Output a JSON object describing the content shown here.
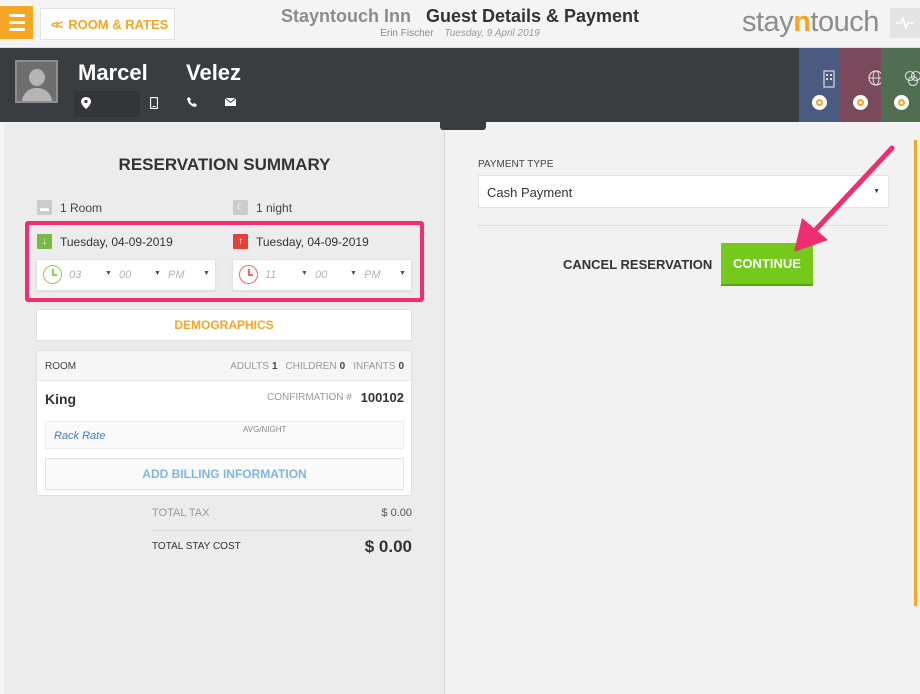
{
  "header": {
    "back_label": "ROOM & RATES",
    "hotel_name": "Stayntouch Inn",
    "page_title": "Guest Details & Payment",
    "user_name": "Erin Fischer",
    "business_date": "Tuesday, 9 April 2019",
    "logo_part1": "stay",
    "logo_part2": "n",
    "logo_part3": "touch",
    "icons": {
      "menu": "hamburger-icon",
      "back": "double-chevron-left-icon",
      "logo_button": "heartbeat-icon"
    }
  },
  "guest": {
    "first_name": "Marcel",
    "last_name": "Velez",
    "icons": [
      "location-pin-icon",
      "mobile-phone-icon",
      "phone-icon",
      "email-icon"
    ]
  },
  "tiles": [
    {
      "name": "building",
      "color": "#4a5a80",
      "glyph": "▥"
    },
    {
      "name": "globe",
      "color": "#7a4a5c",
      "glyph": "⊕"
    },
    {
      "name": "rings",
      "color": "#4f6e52",
      "glyph": "⚭"
    }
  ],
  "summary": {
    "title": "RESERVATION SUMMARY",
    "rooms": "1 Room",
    "nights": "1 night",
    "arrival_date": "Tuesday, 04-09-2019",
    "departure_date": "Tuesday, 04-09-2019",
    "arrival_time": {
      "hour": "03",
      "minute": "00",
      "ampm": "PM"
    },
    "departure_time": {
      "hour": "11",
      "minute": "00",
      "ampm": "PM"
    },
    "colors": {
      "arrival": "#7ab648",
      "departure": "#e0433a",
      "highlight": "#ef2e72"
    }
  },
  "demographics_label": "DEMOGRAPHICS",
  "room": {
    "header_label": "ROOM",
    "adults_label": "ADULTS",
    "adults": "1",
    "children_label": "CHILDREN",
    "children": "0",
    "infants_label": "INFANTS",
    "infants": "0",
    "type": "King",
    "confirmation_label": "CONFIRMATION #",
    "confirmation": "100102",
    "rate_name": "Rack Rate",
    "avg_label": "AVG/NIGHT",
    "billing_label": "ADD BILLING INFORMATION"
  },
  "totals": {
    "tax_label": "TOTAL TAX",
    "tax_value": "$ 0.00",
    "stay_label": "TOTAL STAY COST",
    "stay_value": "$ 0.00"
  },
  "payment": {
    "label": "PAYMENT TYPE",
    "selected": "Cash Payment",
    "cancel_label": "CANCEL RESERVATION",
    "continue_label": "CONTINUE",
    "accent": "#74c91a"
  }
}
